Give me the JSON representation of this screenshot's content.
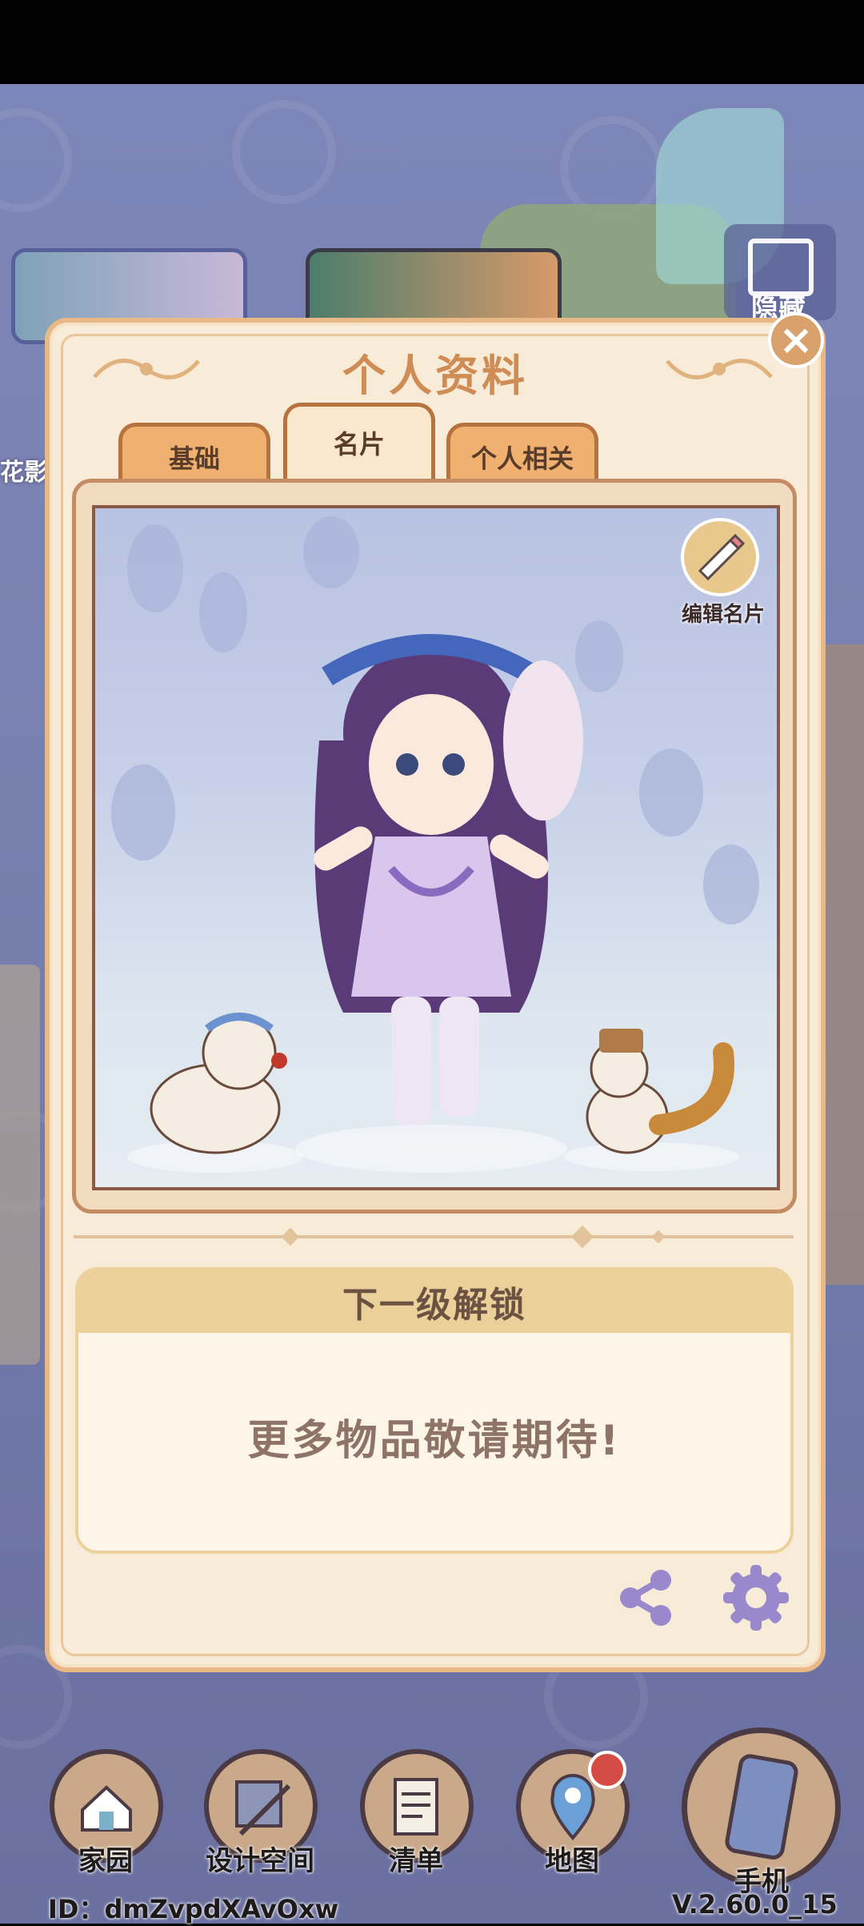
{
  "hud": {
    "hide_label": "隐藏",
    "side_label": "花影"
  },
  "panel": {
    "title": "个人资料",
    "tabs": [
      {
        "label": "基础",
        "active": false
      },
      {
        "label": "名片",
        "active": true
      },
      {
        "label": "个人相关",
        "active": false
      }
    ],
    "edit_card_label": "编辑名片",
    "unlock_heading": "下一级解锁",
    "unlock_message": "更多物品敬请期待!"
  },
  "nav": {
    "items": [
      {
        "label": "家园",
        "icon": "house-icon"
      },
      {
        "label": "设计空间",
        "icon": "design-icon"
      },
      {
        "label": "清单",
        "icon": "list-icon"
      },
      {
        "label": "地图",
        "icon": "map-pin-icon"
      }
    ],
    "phone_label": "手机"
  },
  "footer": {
    "user_id": "ID：dmZvpdXAvOxw",
    "version": "V.2.60.0_15"
  },
  "colors": {
    "panel_bg": "#f8ecd9",
    "title": "#cf8d55",
    "tab_active": "#fbe7cb",
    "tab_inactive": "#f0b06f",
    "accent_purple": "#9a88cc"
  }
}
